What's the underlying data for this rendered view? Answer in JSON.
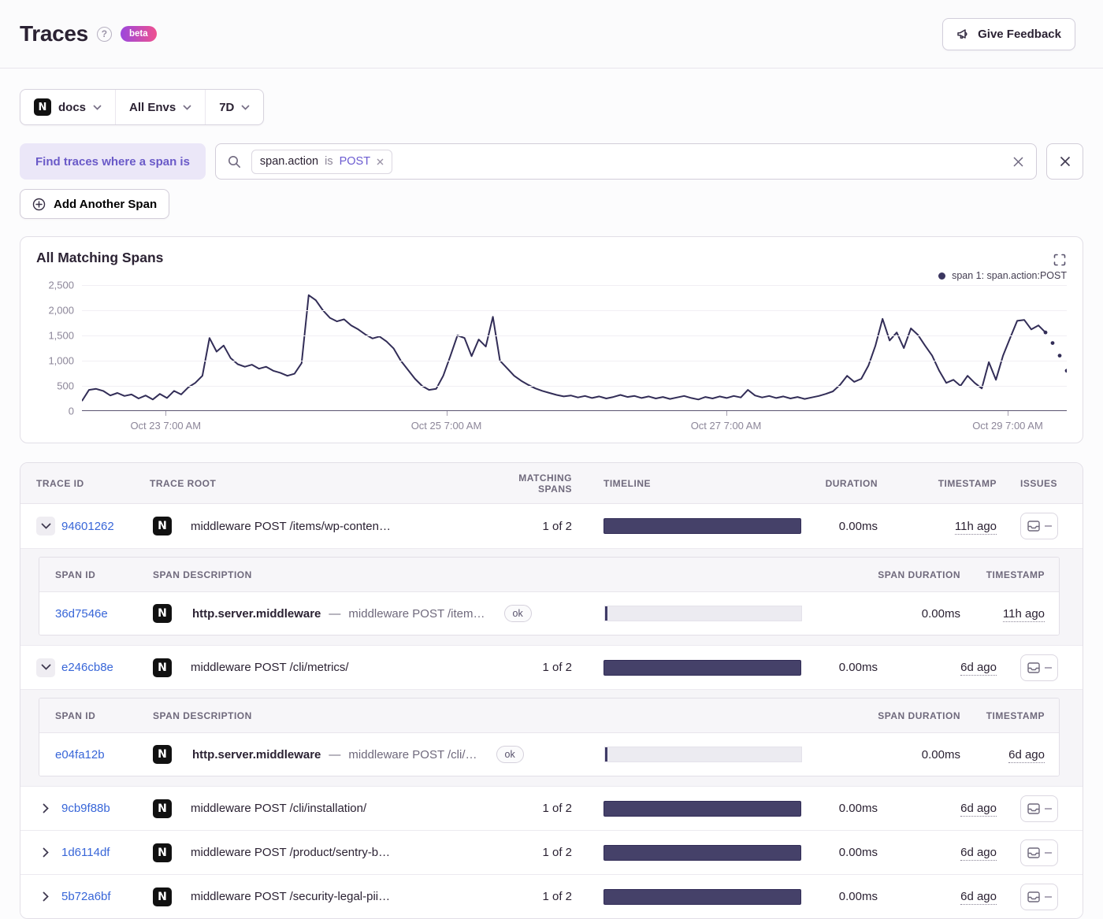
{
  "header": {
    "title": "Traces",
    "beta_label": "beta",
    "feedback_label": "Give Feedback"
  },
  "filters": {
    "project": "docs",
    "project_icon": "nextjs-logo",
    "environment": "All Envs",
    "period": "7D"
  },
  "search": {
    "find_label": "Find traces where a span is",
    "token": {
      "key": "span.action",
      "operator": "is",
      "value": "POST"
    },
    "add_span_label": "Add Another Span"
  },
  "chart": {
    "title": "All Matching Spans",
    "legend": "span 1: span.action:POST"
  },
  "chart_data": {
    "type": "line",
    "title": "All Matching Spans",
    "legend_entries": [
      "span 1: span.action:POST"
    ],
    "legend_position": "top-right",
    "grid": "horizontal",
    "ylim": [
      0,
      2500
    ],
    "y_ticks": [
      "0",
      "500",
      "1,000",
      "1,500",
      "2,000",
      "2,500"
    ],
    "x_ticks": [
      {
        "label": "Oct 23 7:00 AM",
        "frac": 0.085
      },
      {
        "label": "Oct 25 7:00 AM",
        "frac": 0.37
      },
      {
        "label": "Oct 27 7:00 AM",
        "frac": 0.654
      },
      {
        "label": "Oct 29 7:00 AM",
        "frac": 0.94
      }
    ],
    "dotted_tail_from": 137,
    "values": [
      200,
      420,
      440,
      400,
      310,
      360,
      300,
      330,
      250,
      310,
      230,
      340,
      260,
      400,
      330,
      470,
      560,
      700,
      1450,
      1180,
      1300,
      1050,
      930,
      880,
      920,
      840,
      880,
      800,
      760,
      700,
      740,
      950,
      2300,
      2200,
      2000,
      1850,
      1780,
      1820,
      1700,
      1620,
      1520,
      1440,
      1480,
      1380,
      1240,
      1000,
      820,
      640,
      500,
      420,
      440,
      700,
      1090,
      1500,
      1450,
      1090,
      1420,
      1280,
      1870,
      1000,
      850,
      700,
      600,
      520,
      450,
      400,
      360,
      320,
      290,
      310,
      270,
      300,
      260,
      290,
      250,
      280,
      320,
      280,
      300,
      260,
      290,
      250,
      280,
      240,
      270,
      300,
      260,
      230,
      280,
      250,
      290,
      260,
      300,
      270,
      420,
      310,
      270,
      300,
      260,
      290,
      250,
      280,
      240,
      270,
      300,
      340,
      390,
      520,
      700,
      580,
      640,
      900,
      1300,
      1830,
      1400,
      1560,
      1250,
      1640,
      1510,
      1300,
      1100,
      800,
      560,
      620,
      500,
      700,
      560,
      450,
      970,
      620,
      1100,
      1450,
      1790,
      1810,
      1620,
      1700,
      1560,
      1350,
      1100,
      800
    ]
  },
  "table": {
    "columns": [
      "TRACE ID",
      "TRACE ROOT",
      "MATCHING SPANS",
      "TIMELINE",
      "DURATION",
      "TIMESTAMP",
      "ISSUES"
    ],
    "sub_columns": [
      "SPAN ID",
      "SPAN DESCRIPTION",
      "SPAN DURATION",
      "TIMESTAMP"
    ],
    "rows": [
      {
        "trace_id": "94601262",
        "expanded": true,
        "root": "middleware POST /items/wp-conten…",
        "matching_spans": "1 of 2",
        "duration": "0.00ms",
        "timestamp": "11h ago",
        "spans": [
          {
            "span_id": "36d7546e",
            "op": "http.server.middleware",
            "separator": "—",
            "description": "middleware POST /item…",
            "status": "ok",
            "duration": "0.00ms",
            "timestamp": "11h ago"
          }
        ]
      },
      {
        "trace_id": "e246cb8e",
        "expanded": true,
        "root": "middleware POST /cli/metrics/",
        "matching_spans": "1 of 2",
        "duration": "0.00ms",
        "timestamp": "6d ago",
        "spans": [
          {
            "span_id": "e04fa12b",
            "op": "http.server.middleware",
            "separator": "—",
            "description": "middleware POST /cli/…",
            "status": "ok",
            "duration": "0.00ms",
            "timestamp": "6d ago"
          }
        ]
      },
      {
        "trace_id": "9cb9f88b",
        "expanded": false,
        "root": "middleware POST /cli/installation/",
        "matching_spans": "1 of 2",
        "duration": "0.00ms",
        "timestamp": "6d ago",
        "spans": []
      },
      {
        "trace_id": "1d6114df",
        "expanded": false,
        "root": "middleware POST /product/sentry-b…",
        "matching_spans": "1 of 2",
        "duration": "0.00ms",
        "timestamp": "6d ago",
        "spans": []
      },
      {
        "trace_id": "5b72a6bf",
        "expanded": false,
        "root": "middleware POST /security-legal-pii…",
        "matching_spans": "1 of 2",
        "duration": "0.00ms",
        "timestamp": "6d ago",
        "spans": []
      }
    ]
  },
  "colors": {
    "accent_purple": "#6c5cd1",
    "link_blue": "#3866d8",
    "chart_line": "#322d57",
    "timeline_bar": "#454169",
    "beta_gradient_start": "#9b47dd",
    "beta_gradient_end": "#ef5190"
  }
}
